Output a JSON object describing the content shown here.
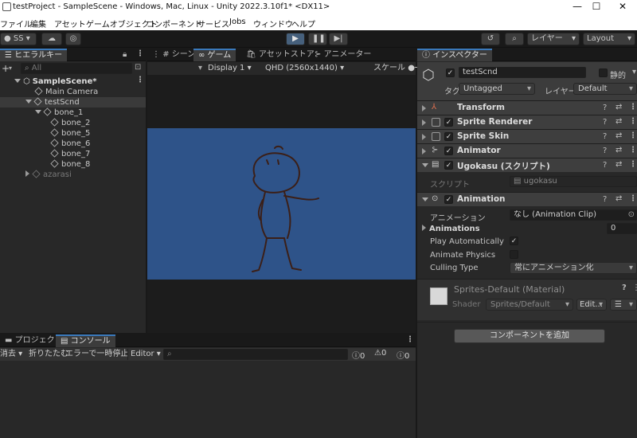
{
  "window": {
    "title": "testProject - SampleScene - Windows, Mac, Linux - Unity 2022.3.10f1* <DX11>",
    "controls": [
      "—",
      "☐",
      "✕"
    ]
  },
  "menu": [
    "ファイル",
    "編集",
    "アセット",
    "ゲームオブジェクト",
    "コンポーネント",
    "サービス",
    "Jobs",
    "ウィンドウ",
    "ヘルプ"
  ],
  "toolbar": {
    "account": "SS",
    "layers": "レイヤー",
    "layout": "Layout"
  },
  "hierarchy": {
    "tab": "ヒエラルキー",
    "search_placeholder": "All",
    "items": [
      {
        "label": "SampleScene*"
      },
      {
        "label": "Main Camera"
      },
      {
        "label": "testScnd"
      },
      {
        "label": "bone_1"
      },
      {
        "label": "bone_2"
      },
      {
        "label": "bone_5"
      },
      {
        "label": "bone_6"
      },
      {
        "label": "bone_7"
      },
      {
        "label": "bone_8"
      },
      {
        "label": "azarasi"
      }
    ]
  },
  "center": {
    "tabs": [
      "シーン",
      "ゲーム",
      "アセットストア",
      "アニメーター"
    ],
    "display": "Display 1",
    "resolution": "QHD (2560x1440)",
    "scale_label": "スケール"
  },
  "console": {
    "tabs": [
      "プロジェクト",
      "コンソール"
    ],
    "buttons": [
      "消去",
      "折りたたむ",
      "エラーで一時停止"
    ],
    "editor_dropdown": "Editor",
    "counts": [
      "0",
      "0",
      "0"
    ]
  },
  "inspector": {
    "tab": "インスペクター",
    "object_name": "testScnd",
    "static_label": "静的",
    "tag_label": "タグ",
    "tag_value": "Untagged",
    "layer_label": "レイヤー",
    "layer_value": "Default",
    "components": [
      "Transform",
      "Sprite Renderer",
      "Sprite Skin",
      "Animator",
      "Ugokasu (スクリプト)",
      "Animation"
    ],
    "script_label": "スクリプト",
    "script_value": "ugokasu",
    "animation": {
      "clip_label": "アニメーション",
      "clip_value": "なし (Animation Clip)",
      "animations_label": "Animations",
      "animations_count": "0",
      "play_auto_label": "Play Automatically",
      "animate_physics_label": "Animate Physics",
      "culling_label": "Culling Type",
      "culling_value": "常にアニメーション化"
    },
    "material": {
      "name": "Sprites-Default (Material)",
      "shader_label": "Shader",
      "shader_value": "Sprites/Default",
      "edit_button": "Edit..."
    },
    "add_component": "コンポーネントを追加"
  },
  "colors": {
    "game_bg": "#2e5389",
    "accent_tab": "#3a79bb",
    "play_button": "#46607c",
    "drawing_stroke": "#3b1f17"
  }
}
